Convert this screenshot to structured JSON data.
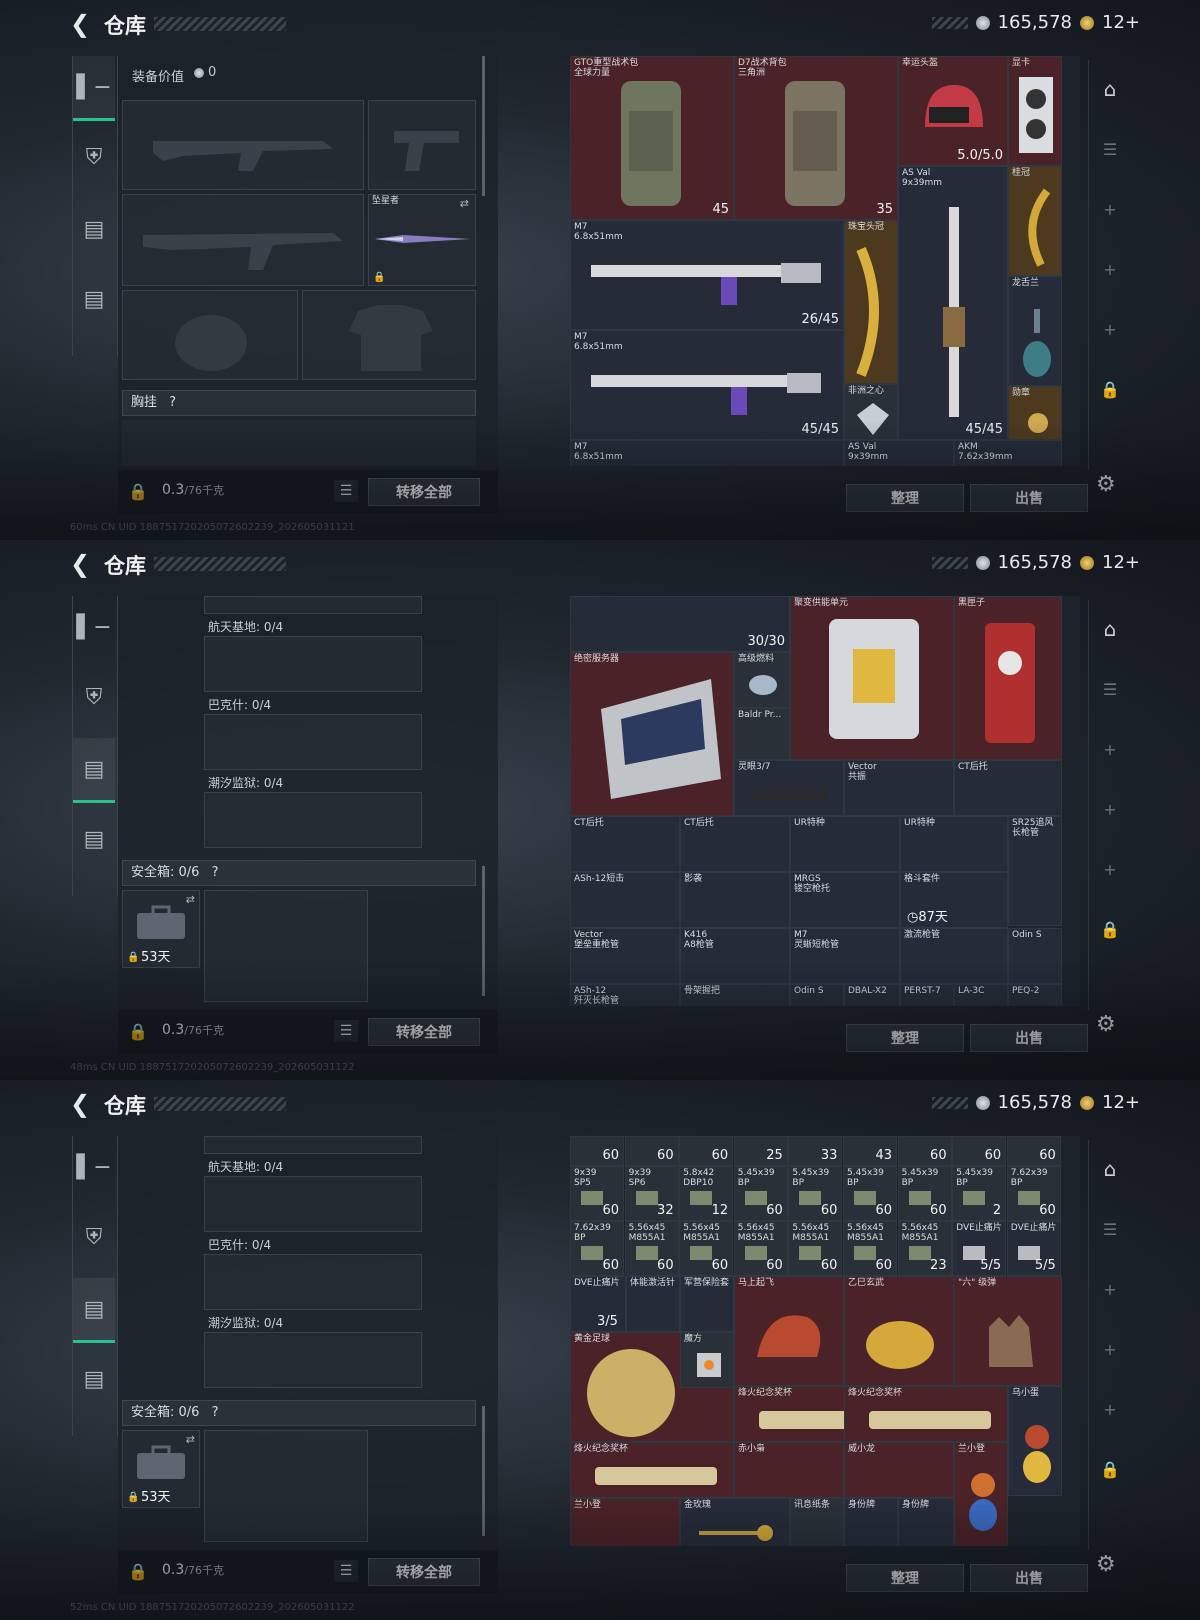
{
  "header": {
    "title": "仓库",
    "silver": "165,578",
    "gold": "12+"
  },
  "equipment_value_label": "装备价值",
  "equipment_value": "0",
  "chest_label": "胸挂",
  "weight": "0.3",
  "weight_cap": "/76千克",
  "transfer_all": "转移全部",
  "sort": "整理",
  "sell": "出售",
  "help": "?",
  "melee_name": "坠星者",
  "containers": [
    {
      "label": "航天基地: 0/4"
    },
    {
      "label": "巴克什: 0/4"
    },
    {
      "label": "潮汐监狱: 0/4"
    }
  ],
  "safebox_label": "安全箱: 0/6",
  "safebox_days": "53天",
  "status_lines": [
    "60ms     CN UID 18875172020507260223­9_20260503112­1",
    "48ms     CN UID 18875172020507260223­9_20260503112­2",
    "52ms     CN UID 18875172020507260223­9_20260503112­2"
  ],
  "panel1_items": [
    {
      "name": "GTO重型战术包\n全球力量",
      "count": "45"
    },
    {
      "name": "D7战术背包\n三角洲",
      "count": "35"
    },
    {
      "name": "幸运头盔",
      "count": "5.0/5.0"
    },
    {
      "name": "显卡",
      "count": ""
    },
    {
      "name": "AS Val\n9x39mm",
      "count": "45/45"
    },
    {
      "name": "桂冠",
      "count": ""
    },
    {
      "name": "M7\n6.8x51mm",
      "count": "26/45"
    },
    {
      "name": "珠宝头冠",
      "count": ""
    },
    {
      "name": "龙舌兰",
      "count": ""
    },
    {
      "name": "M7\n6.8x51mm",
      "count": "45/45"
    },
    {
      "name": "非洲之心",
      "count": ""
    },
    {
      "name": "勋章",
      "count": ""
    },
    {
      "name": "M7\n6.8x51mm",
      "count": ""
    },
    {
      "name": "AS Val\n9x39mm",
      "count": ""
    },
    {
      "name": "AKM\n7.62x39mm",
      "count": ""
    }
  ],
  "panel2_items": [
    {
      "name": "",
      "count": "30/30"
    },
    {
      "name": "聚变供能单元",
      "count": ""
    },
    {
      "name": "黑匣子",
      "count": ""
    },
    {
      "name": "绝密服务器",
      "count": ""
    },
    {
      "name": "高级燃料",
      "count": ""
    },
    {
      "name": "Baldr Pr...",
      "count": ""
    },
    {
      "name": "灵眼3/7",
      "count": ""
    },
    {
      "name": "Vector\n共振",
      "count": ""
    },
    {
      "name": "CT后托",
      "count": ""
    },
    {
      "name": "CT后托",
      "count": ""
    },
    {
      "name": "CT后托",
      "count": ""
    },
    {
      "name": "UR特种",
      "count": ""
    },
    {
      "name": "UR特种",
      "count": ""
    },
    {
      "name": "SR25追风\n长枪管",
      "count": ""
    },
    {
      "name": "ASh-12短击",
      "count": ""
    },
    {
      "name": "影袭",
      "count": ""
    },
    {
      "name": "MRGS\n镂空枪托",
      "count": ""
    },
    {
      "name": "格斗套件",
      "count": "87天"
    },
    {
      "name": "Vector\n堡垒重枪管",
      "count": ""
    },
    {
      "name": "K416\nA8枪管",
      "count": ""
    },
    {
      "name": "M7\n灵蜥短枪管",
      "count": ""
    },
    {
      "name": "激流枪管",
      "count": ""
    },
    {
      "name": "Odin S",
      "count": ""
    },
    {
      "name": "ASh-12\n歼灭长枪管",
      "count": ""
    },
    {
      "name": "骨架握把",
      "count": ""
    },
    {
      "name": "Odin S",
      "count": ""
    },
    {
      "name": "DBAL-X2",
      "count": ""
    },
    {
      "name": "PERST-7",
      "count": ""
    },
    {
      "name": "LA-3C",
      "count": ""
    },
    {
      "name": "PEQ-2",
      "count": ""
    }
  ],
  "panel3_toprow": [
    "60",
    "60",
    "60",
    "25",
    "33",
    "43",
    "60",
    "60",
    "60"
  ],
  "panel3_ammo": [
    {
      "name": "9x39\nSP5",
      "count": "60"
    },
    {
      "name": "9x39\nSP6",
      "count": "32"
    },
    {
      "name": "5.8x42\nDBP10",
      "count": "12"
    },
    {
      "name": "5.45x39\nBP",
      "count": "60"
    },
    {
      "name": "5.45x39\nBP",
      "count": "60"
    },
    {
      "name": "5.45x39\nBP",
      "count": "60"
    },
    {
      "name": "5.45x39\nBP",
      "count": "60"
    },
    {
      "name": "5.45x39\nBP",
      "count": "2"
    },
    {
      "name": "7.62x39\nBP",
      "count": "60"
    },
    {
      "name": "7.62x39\nBP",
      "count": "60"
    },
    {
      "name": "5.56x45\nM855A1",
      "count": "60"
    },
    {
      "name": "5.56x45\nM855A1",
      "count": "60"
    },
    {
      "name": "5.56x45\nM855A1",
      "count": "60"
    },
    {
      "name": "5.56x45\nM855A1",
      "count": "60"
    },
    {
      "name": "5.56x45\nM855A1",
      "count": "60"
    },
    {
      "name": "5.56x45\nM855A1",
      "count": "23"
    },
    {
      "name": "DVE止痛片",
      "count": "5/5"
    },
    {
      "name": "DVE止痛片",
      "count": "5/5"
    }
  ],
  "panel3_items": [
    {
      "name": "DVE止痛片",
      "count": "3/5"
    },
    {
      "name": "体能激活针",
      "count": ""
    },
    {
      "name": "军营保险套",
      "count": ""
    },
    {
      "name": "马上起飞",
      "count": ""
    },
    {
      "name": "乙巳玄武",
      "count": ""
    },
    {
      "name": "\"六\" 级弹",
      "count": ""
    },
    {
      "name": "黄金足球",
      "count": ""
    },
    {
      "name": "魔方",
      "count": ""
    },
    {
      "name": "烽火纪念奖杯",
      "count": ""
    },
    {
      "name": "烽火纪念奖杯",
      "count": ""
    },
    {
      "name": "乌小蛋",
      "count": ""
    },
    {
      "name": "烽火纪念奖杯",
      "count": ""
    },
    {
      "name": "赤小枭",
      "count": ""
    },
    {
      "name": "威小龙",
      "count": ""
    },
    {
      "name": "兰小登",
      "count": ""
    },
    {
      "name": "兰小登",
      "count": ""
    },
    {
      "name": "金玫瑰",
      "count": ""
    },
    {
      "name": "讯息纸条",
      "count": ""
    },
    {
      "name": "身份牌",
      "count": ""
    },
    {
      "name": "身份牌",
      "count": ""
    }
  ]
}
